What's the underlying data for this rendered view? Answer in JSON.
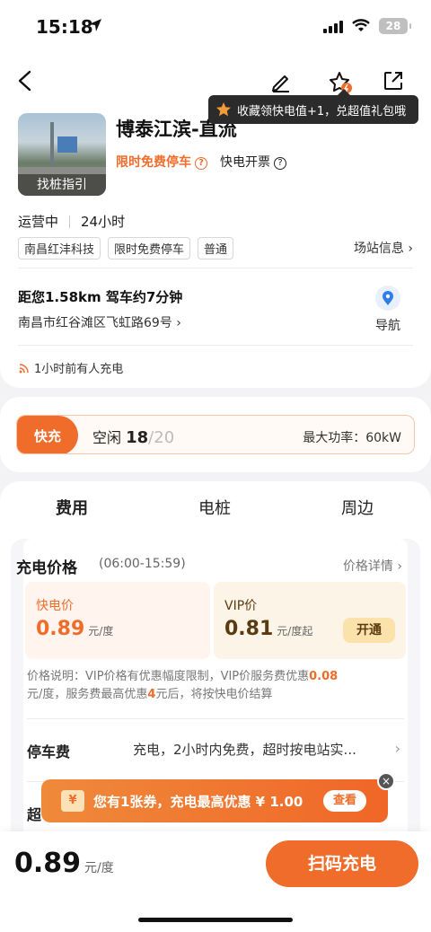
{
  "status": {
    "time": "15:18",
    "battery": "28"
  },
  "tooltip": {
    "text": "收藏领快电值+1，兑超值礼包哦"
  },
  "station": {
    "name": "博泰江滨-直流",
    "thumb_caption": "找桩指引",
    "free_parking": "限时免费停车",
    "fast_invoice": "快电开票",
    "state": "运营中",
    "hours": "24小时",
    "tags": [
      "南昌红沣科技",
      "限时免费停车",
      "普通"
    ],
    "info_link": "场站信息",
    "distance": "距您1.58km 驾车约7分钟",
    "address": "南昌市红谷滩区飞虹路69号",
    "navigate": "导航",
    "recent": "1小时前有人充电"
  },
  "fast": {
    "tag": "快充",
    "idle_label": "空闲",
    "idle": "18",
    "total": "/20",
    "max_power": "最大功率：60kW"
  },
  "tabs": [
    "费用",
    "电桩",
    "周边"
  ],
  "price": {
    "title": "充电价格",
    "time": "(06:00-15:59)",
    "detail_link": "价格详情",
    "fast_label": "快电价",
    "fast_value": "0.89",
    "fast_unit": "元/度",
    "vip_label": "VIP价",
    "vip_value": "0.81",
    "vip_unit": "元/度起",
    "open_btn": "开通",
    "note_a": "价格说明：VIP价格有优惠幅度限制，VIP价服务费优惠",
    "note_b": "0.08",
    "note_c": "元/度，服务费最高优惠",
    "note_d": "4",
    "note_e": "元后，将按快电价结算"
  },
  "parking": {
    "label": "停车费",
    "value": "充电，2小时内免费，超时按电站实..."
  },
  "over_label": "超",
  "coupon": {
    "icon": "¥",
    "text": "您有1张券，充电最高优惠 ¥ 1.00",
    "view": "查看",
    "close": "×"
  },
  "bottom": {
    "price": "0.89",
    "unit": "元/度",
    "scan": "扫码充电"
  },
  "colors": {
    "accent": "#ef6c2b",
    "nav_blue": "#2f7ee8"
  }
}
